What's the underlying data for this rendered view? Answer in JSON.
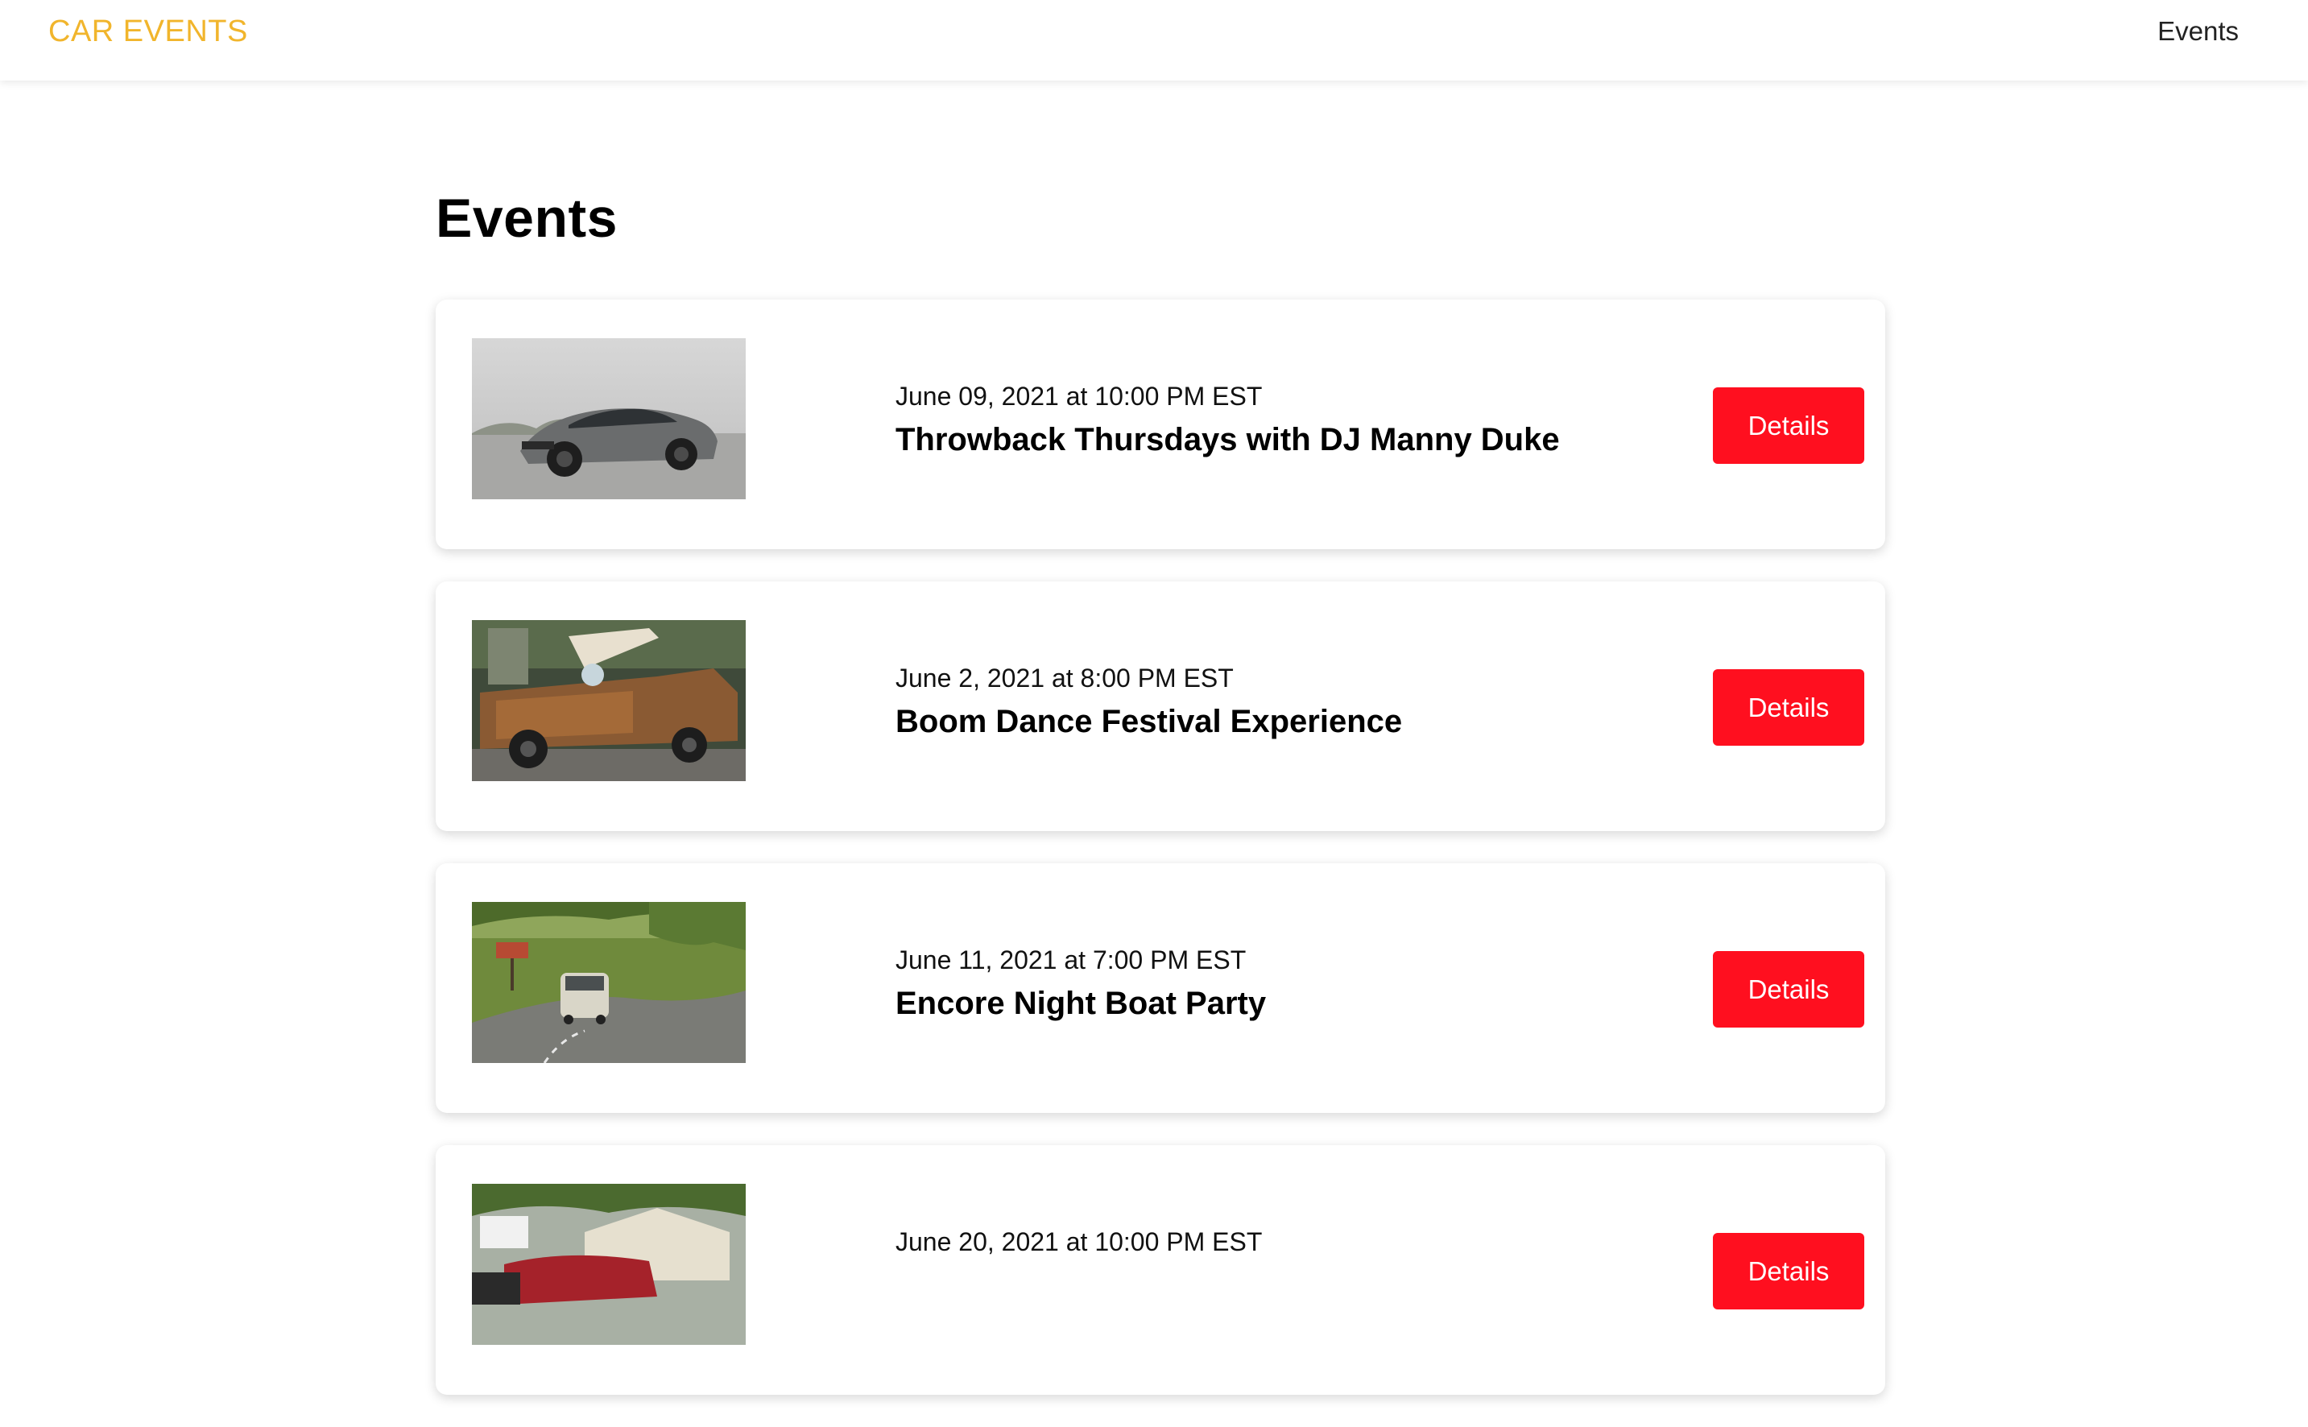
{
  "nav": {
    "brand": "CAR EVENTS",
    "link": "Events"
  },
  "page": {
    "title": "Events"
  },
  "events": [
    {
      "date": "June 09, 2021 at 10:00 PM EST",
      "name": "Throwback Thursdays with DJ Manny Duke",
      "button": "Details"
    },
    {
      "date": "June 2, 2021 at 8:00 PM EST",
      "name": "Boom Dance Festival Experience",
      "button": "Details"
    },
    {
      "date": "June 11, 2021 at 7:00 PM EST",
      "name": "Encore Night Boat Party",
      "button": "Details"
    },
    {
      "date": "June 20, 2021 at 10:00 PM EST",
      "name": "",
      "button": "Details"
    }
  ],
  "colors": {
    "brand": "#f1b52c",
    "button": "#ff0f1f"
  }
}
